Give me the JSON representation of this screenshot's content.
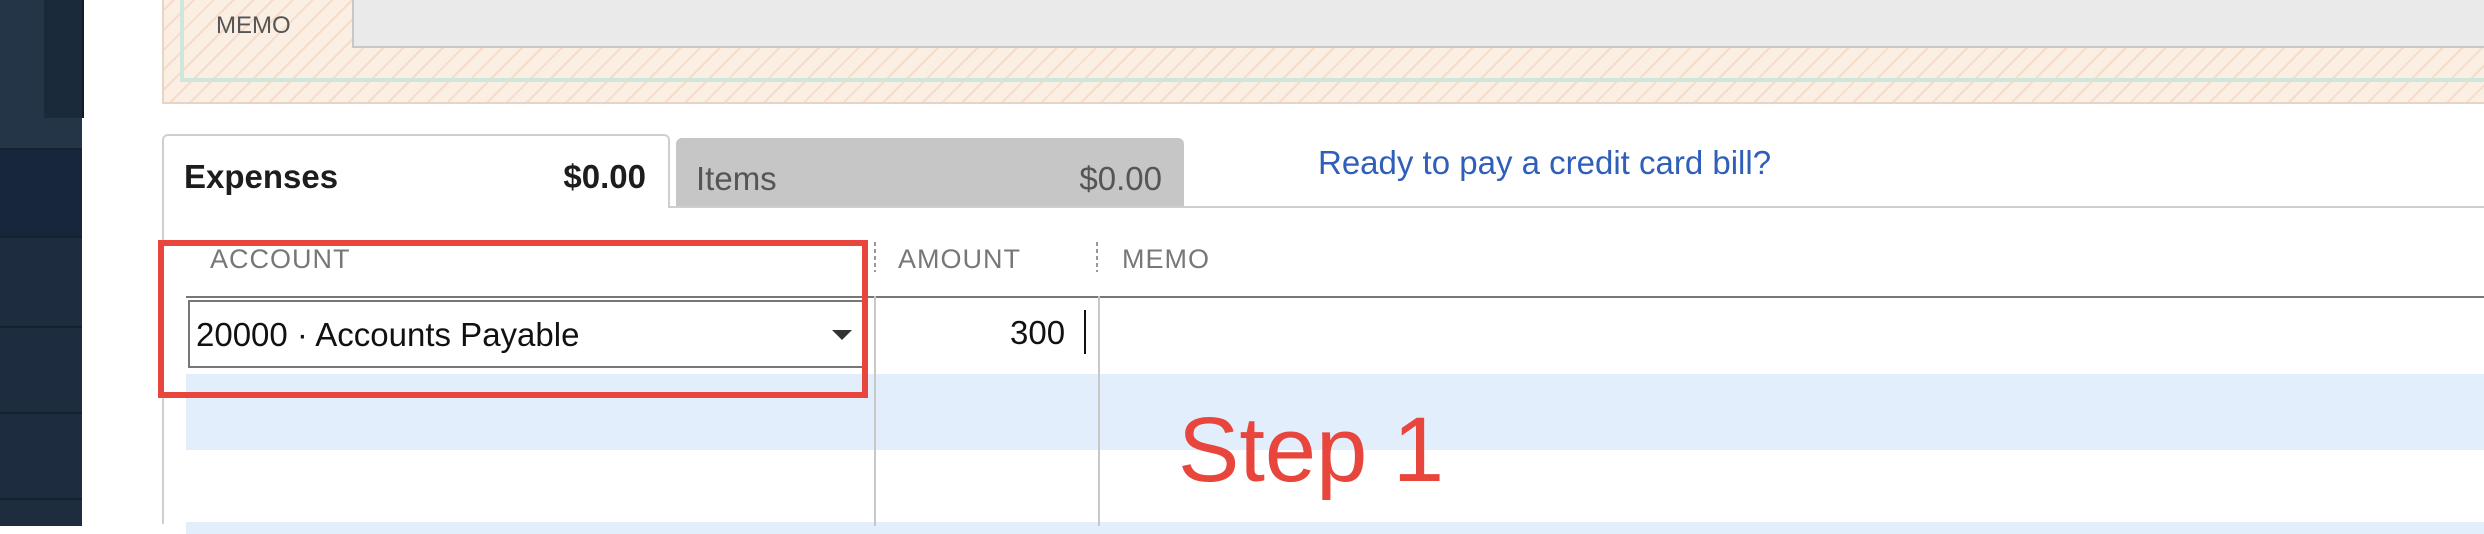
{
  "memo": {
    "label": "MEMO"
  },
  "tabs": {
    "expenses": {
      "label": "Expenses",
      "amount": "$0.00"
    },
    "items": {
      "label": "Items",
      "amount": "$0.00"
    }
  },
  "link": {
    "credit_card": "Ready to pay a credit card bill?"
  },
  "grid": {
    "columns": {
      "account": "ACCOUNT",
      "amount": "AMOUNT",
      "memo": "MEMO"
    },
    "row1": {
      "account": "20000 · Accounts Payable",
      "amount": "300",
      "memo": ""
    }
  },
  "annotation": {
    "step": "Step 1"
  },
  "colors": {
    "annotation_red": "#e8453c",
    "link_blue": "#2f5fb8",
    "row_stripe": "#e3eefc"
  },
  "icons": [
    "dropdown-arrow-icon"
  ]
}
